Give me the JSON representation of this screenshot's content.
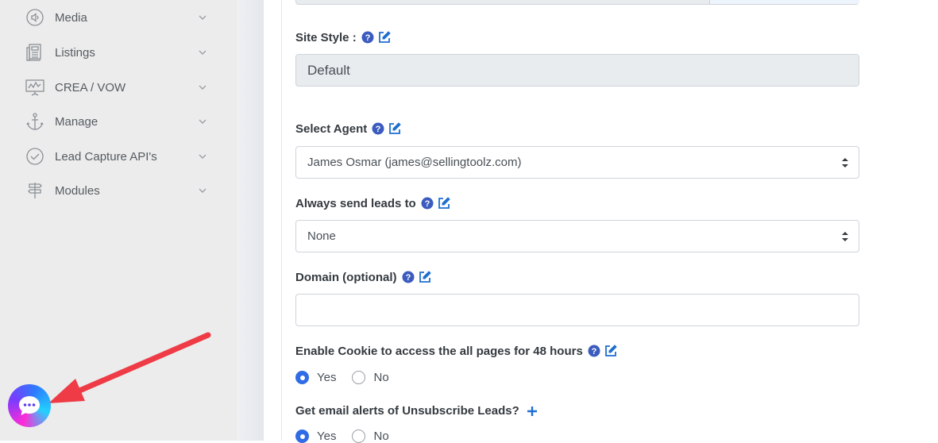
{
  "sidebar": {
    "items": [
      {
        "label": "Media",
        "icon": "speaker-icon"
      },
      {
        "label": "Listings",
        "icon": "listings-icon"
      },
      {
        "label": "CREA / VOW",
        "icon": "presentation-board-icon"
      },
      {
        "label": "Manage",
        "icon": "anchor-icon"
      },
      {
        "label": "Lead Capture API's",
        "icon": "check-circle-icon"
      },
      {
        "label": "Modules",
        "icon": "signpost-icon"
      }
    ]
  },
  "form": {
    "site_style": {
      "label": "Site Style :",
      "value": "Default"
    },
    "select_agent": {
      "label": "Select Agent",
      "value": "James Osmar (james@sellingtoolz.com)"
    },
    "always_send": {
      "label": "Always send leads to",
      "value": "None"
    },
    "domain": {
      "label": "Domain (optional)",
      "value": ""
    },
    "cookie": {
      "label": "Enable Cookie to access the all pages for 48 hours",
      "yes": "Yes",
      "no": "No",
      "selected": "Yes"
    },
    "email_alerts": {
      "label": "Get email alerts of Unsubscribe Leads?",
      "yes": "Yes",
      "no": "No",
      "selected": "Yes"
    }
  },
  "colors": {
    "accent": "#2f6ce5",
    "help_icon": "#3b5bbf",
    "edit_icon": "#1f6fd0",
    "arrow": "#ee3b46"
  },
  "chat": {
    "icon": "chat-bubble-icon"
  },
  "annotation": {
    "icon": "red-arrow-icon"
  }
}
